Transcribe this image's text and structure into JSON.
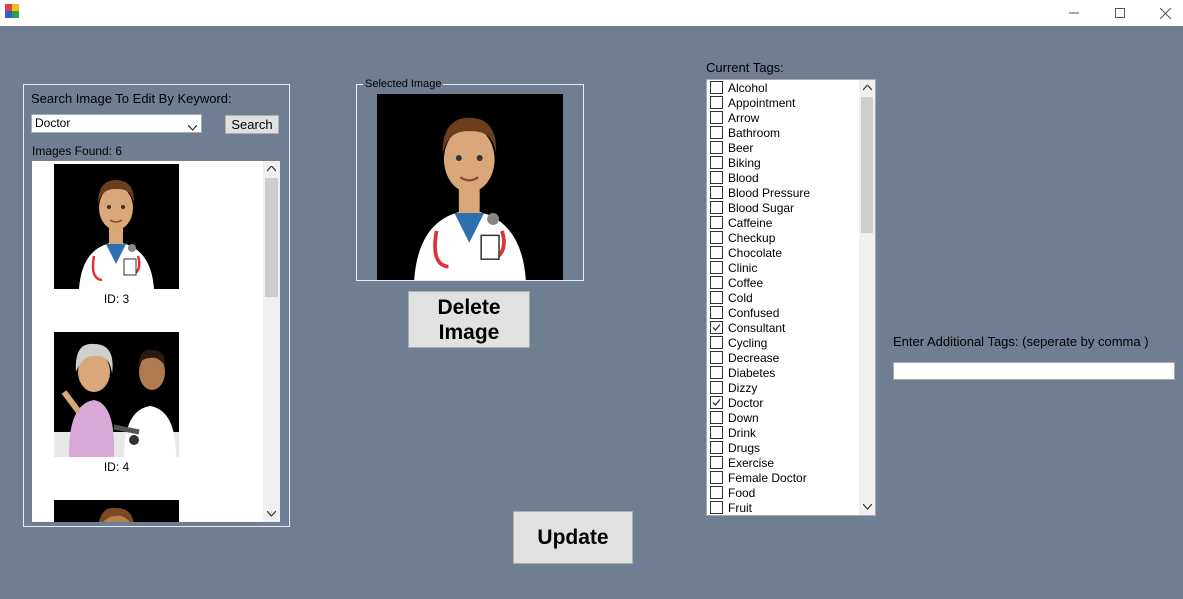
{
  "window": {
    "icon": "app-window-icon",
    "controls": [
      "minimize-icon",
      "maximize-icon",
      "close-icon"
    ]
  },
  "search": {
    "label": "Search Image To Edit By Keyword:",
    "keyword_value": "Doctor",
    "button_label": "Search",
    "images_found": "Images Found: 6",
    "results": [
      {
        "id_label": "ID: 3",
        "image": "doctor-portrait"
      },
      {
        "id_label": "ID: 4",
        "image": "doctor-checking-blood-pressure"
      },
      {
        "id_label": "",
        "image": "partial-portrait"
      }
    ]
  },
  "selected": {
    "legend": "Selected Image",
    "image": "doctor-portrait",
    "delete_line1": "Delete",
    "delete_line2": "Image"
  },
  "tags": {
    "label": "Current Tags:",
    "items": [
      {
        "label": "Alcohol",
        "checked": false
      },
      {
        "label": "Appointment",
        "checked": false
      },
      {
        "label": "Arrow",
        "checked": false
      },
      {
        "label": "Bathroom",
        "checked": false
      },
      {
        "label": "Beer",
        "checked": false
      },
      {
        "label": "Biking",
        "checked": false
      },
      {
        "label": "Blood",
        "checked": false
      },
      {
        "label": "Blood Pressure",
        "checked": false
      },
      {
        "label": "Blood Sugar",
        "checked": false
      },
      {
        "label": "Caffeine",
        "checked": false
      },
      {
        "label": "Checkup",
        "checked": false
      },
      {
        "label": "Chocolate",
        "checked": false
      },
      {
        "label": "Clinic",
        "checked": false
      },
      {
        "label": "Coffee",
        "checked": false
      },
      {
        "label": "Cold",
        "checked": false
      },
      {
        "label": "Confused",
        "checked": false
      },
      {
        "label": "Consultant",
        "checked": true
      },
      {
        "label": "Cycling",
        "checked": false
      },
      {
        "label": "Decrease",
        "checked": false
      },
      {
        "label": "Diabetes",
        "checked": false
      },
      {
        "label": "Dizzy",
        "checked": false
      },
      {
        "label": "Doctor",
        "checked": true
      },
      {
        "label": "Down",
        "checked": false
      },
      {
        "label": "Drink",
        "checked": false
      },
      {
        "label": "Drugs",
        "checked": false
      },
      {
        "label": "Exercise",
        "checked": false
      },
      {
        "label": "Female Doctor",
        "checked": false
      },
      {
        "label": "Food",
        "checked": false
      },
      {
        "label": "Fruit",
        "checked": false
      }
    ]
  },
  "additional": {
    "label": "Enter Additional Tags: (seperate by comma )",
    "value": ""
  },
  "update_label": "Update",
  "colors": {
    "background": "#6f7f91",
    "button": "#e1e1e1",
    "coat": "#ffffff",
    "shirt": "#2f6fb0",
    "skin": "#d9a77a",
    "hair": "#6b3e1e"
  }
}
